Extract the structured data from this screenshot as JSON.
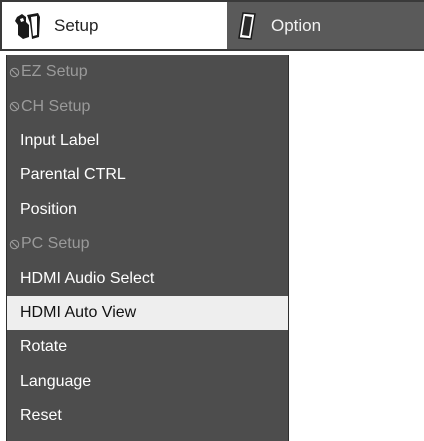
{
  "tabs": {
    "setup": {
      "label": "Setup",
      "icon": "wrench-hand-icon"
    },
    "option": {
      "label": "Option",
      "icon": "card-icon"
    }
  },
  "menu": {
    "items": [
      {
        "label": "EZ Setup",
        "state": "disabled"
      },
      {
        "label": "CH Setup",
        "state": "disabled"
      },
      {
        "label": "Input Label",
        "state": "normal"
      },
      {
        "label": "Parental CTRL",
        "state": "normal"
      },
      {
        "label": "Position",
        "state": "normal"
      },
      {
        "label": "PC Setup",
        "state": "disabled"
      },
      {
        "label": "HDMI Audio Select",
        "state": "normal"
      },
      {
        "label": "HDMI Auto View",
        "state": "selected"
      },
      {
        "label": "Rotate",
        "state": "normal"
      },
      {
        "label": "Language",
        "state": "normal"
      },
      {
        "label": "Reset",
        "state": "normal"
      }
    ]
  },
  "colors": {
    "menu_background": "#4d4d4d",
    "selected_background": "#eeeeee",
    "disabled_text": "#9a9a9a",
    "inactive_tab": "#5a5a5a"
  }
}
